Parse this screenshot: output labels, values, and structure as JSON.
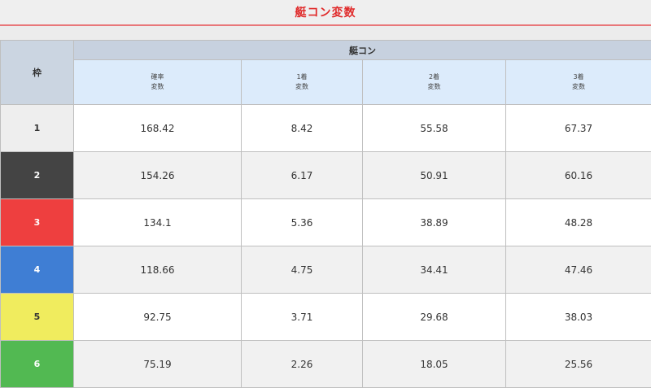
{
  "page_title": "艇コン変数",
  "table": {
    "frame_header": "枠",
    "group_header": "艇コン",
    "columns": [
      {
        "line1": "確率",
        "line2": "変数"
      },
      {
        "line1": "1着",
        "line2": "変数"
      },
      {
        "line1": "2着",
        "line2": "変数"
      },
      {
        "line1": "3着",
        "line2": "変数"
      }
    ],
    "rows": [
      {
        "frame": "1",
        "bg": "#eeeeee",
        "fg": "#333333",
        "values": [
          "168.42",
          "8.42",
          "55.58",
          "67.37"
        ]
      },
      {
        "frame": "2",
        "bg": "#444444",
        "fg": "#ffffff",
        "values": [
          "154.26",
          "6.17",
          "50.91",
          "60.16"
        ]
      },
      {
        "frame": "3",
        "bg": "#ee3f3f",
        "fg": "#ffffff",
        "values": [
          "134.1",
          "5.36",
          "38.89",
          "48.28"
        ]
      },
      {
        "frame": "4",
        "bg": "#3f7ed4",
        "fg": "#ffffff",
        "values": [
          "118.66",
          "4.75",
          "34.41",
          "47.46"
        ]
      },
      {
        "frame": "5",
        "bg": "#f0ec5e",
        "fg": "#333333",
        "values": [
          "92.75",
          "3.71",
          "29.68",
          "38.03"
        ]
      },
      {
        "frame": "6",
        "bg": "#52b952",
        "fg": "#ffffff",
        "values": [
          "75.19",
          "2.26",
          "18.05",
          "25.56"
        ]
      }
    ]
  }
}
